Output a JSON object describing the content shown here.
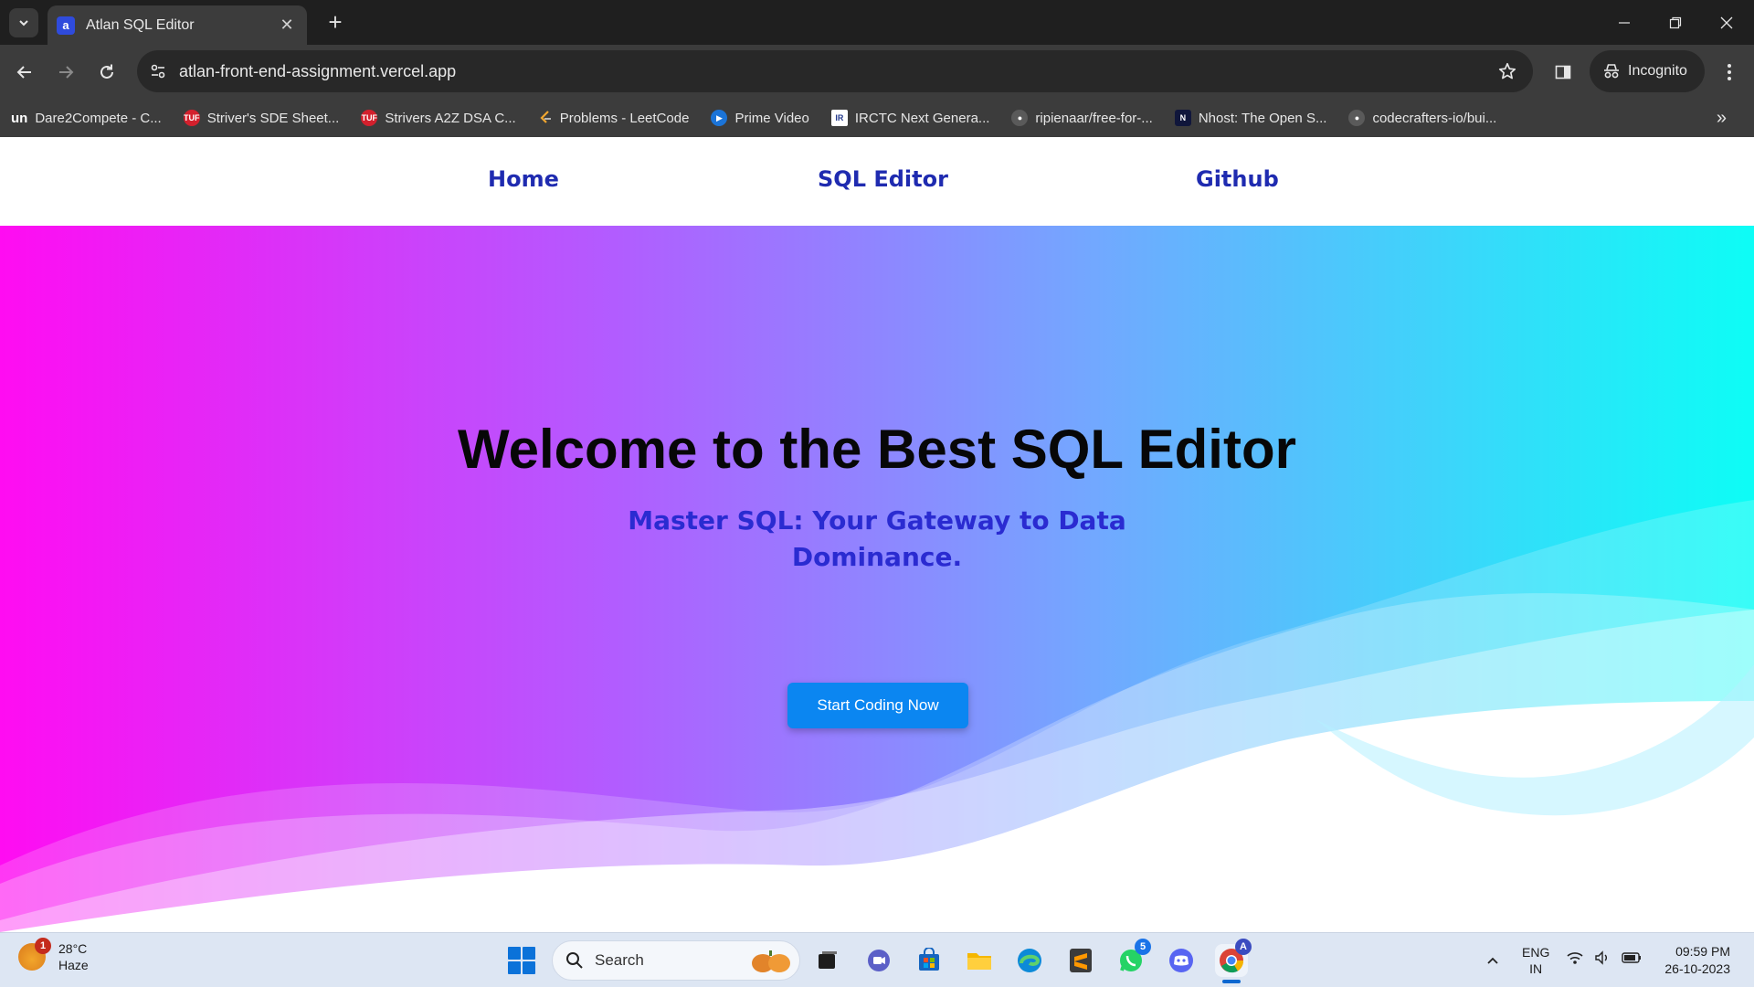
{
  "browser": {
    "tab_title": "Atlan SQL Editor",
    "tab_favicon_letter": "a",
    "url": "atlan-front-end-assignment.vercel.app",
    "incognito_label": "Incognito",
    "bookmarks": [
      {
        "label": "Dare2Compete - C...",
        "icon": "un",
        "color": "#2a2a6e"
      },
      {
        "label": "Striver's SDE Sheet...",
        "icon": "TUF",
        "color": "#d3202d"
      },
      {
        "label": "Strivers A2Z DSA C...",
        "icon": "TUF",
        "color": "#d3202d"
      },
      {
        "label": "Problems - LeetCode",
        "icon": "leetcode-icon",
        "color": "#f0a630"
      },
      {
        "label": "Prime Video",
        "icon": "prime-video-icon",
        "color": "#1b74d8"
      },
      {
        "label": "IRCTC Next Genera...",
        "icon": "irctc-icon",
        "color": "#243a8c"
      },
      {
        "label": "ripienaar/free-for-...",
        "icon": "github-icon",
        "color": "#5a5a5a"
      },
      {
        "label": "Nhost: The Open S...",
        "icon": "nhost-icon",
        "color": "#10163b"
      },
      {
        "label": "codecrafters-io/bui...",
        "icon": "github-icon",
        "color": "#5a5a5a"
      }
    ]
  },
  "site": {
    "nav": {
      "home": "Home",
      "editor": "SQL Editor",
      "github": "Github"
    },
    "hero": {
      "title": "Welcome to the Best SQL Editor",
      "subtitle": "Master SQL: Your Gateway to Data Dominance.",
      "cta": "Start Coding Now"
    },
    "colors": {
      "nav_link": "#1f2bb0",
      "subtitle": "#2a2bd1",
      "cta_bg": "#0b86f1",
      "gradient": [
        "#ff0cf2",
        "#b25cff",
        "#73a7ff",
        "#0dfdf6"
      ]
    }
  },
  "taskbar": {
    "weather_temp": "28°C",
    "weather_desc": "Haze",
    "weather_badge": "1",
    "search_label": "Search",
    "whatsapp_badge": "5",
    "chrome_profile_badge": "A",
    "lang_line1": "ENG",
    "lang_line2": "IN",
    "time": "09:59 PM",
    "date": "26-10-2023"
  }
}
